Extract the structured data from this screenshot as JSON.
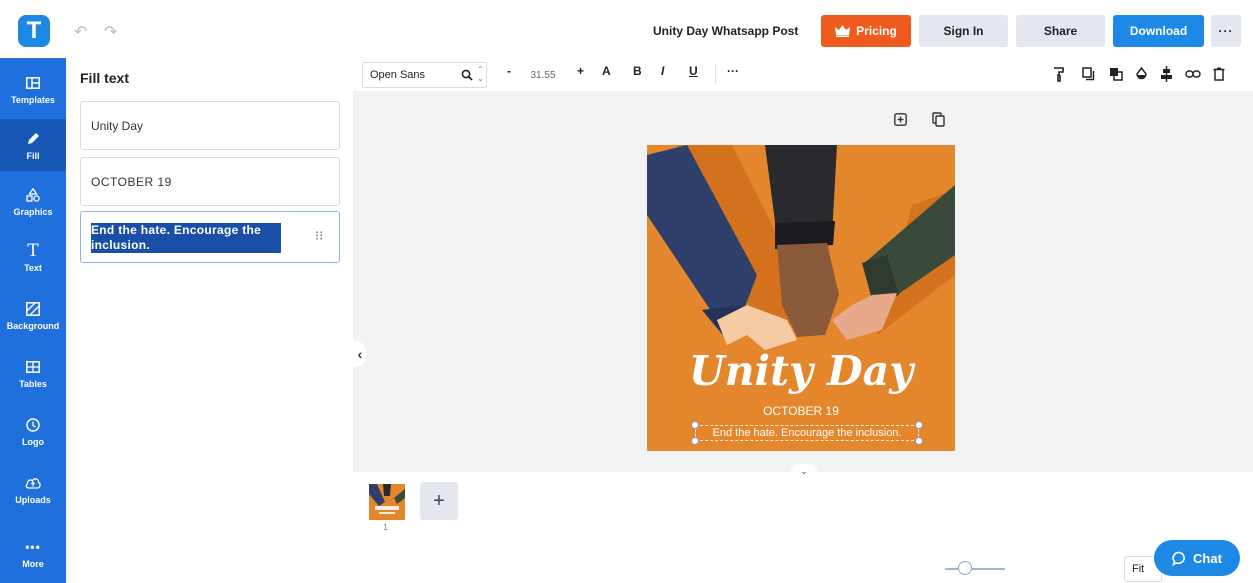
{
  "app": {
    "logo_letter": "T",
    "document_title": "Unity Day Whatsapp Post"
  },
  "topbar": {
    "pricing_label": "Pricing",
    "signin_label": "Sign In",
    "share_label": "Share",
    "download_label": "Download",
    "more_label": "···"
  },
  "sidebar": {
    "items": [
      {
        "label": "Templates",
        "icon": "templates-icon"
      },
      {
        "label": "Fill",
        "icon": "pencil-icon",
        "active": true
      },
      {
        "label": "Graphics",
        "icon": "shapes-icon"
      },
      {
        "label": "Text",
        "icon": "text-icon"
      },
      {
        "label": "Background",
        "icon": "background-icon"
      },
      {
        "label": "Tables",
        "icon": "table-icon"
      },
      {
        "label": "Logo",
        "icon": "logo-icon"
      },
      {
        "label": "Uploads",
        "icon": "upload-icon"
      },
      {
        "label": "More",
        "icon": "more-icon"
      }
    ]
  },
  "panel": {
    "title": "Fill text",
    "fields": [
      {
        "value": "Unity Day"
      },
      {
        "value": "OCTOBER 19"
      },
      {
        "value": "End the hate. Encourage the inclusion.",
        "selected": true
      }
    ]
  },
  "toolbar": {
    "font_family": "Open Sans",
    "font_size": "31.55",
    "decrease": "-",
    "increase": "+",
    "case": "A",
    "bold": "B",
    "italic": "I",
    "underline": "U",
    "more": "···"
  },
  "poster": {
    "title": "Unity Day",
    "date": "OCTOBER 19",
    "tagline": "End the hate. Encourage the inclusion."
  },
  "pages": {
    "current_page": "1",
    "add_label": "+"
  },
  "zoom": {
    "mode": "Fit"
  },
  "chat": {
    "label": "Chat"
  },
  "colors": {
    "brand_blue": "#1e88e5",
    "sidebar_blue": "#1f6fdc",
    "pricing_orange": "#ef5a1f",
    "poster_orange": "#e3862c"
  }
}
